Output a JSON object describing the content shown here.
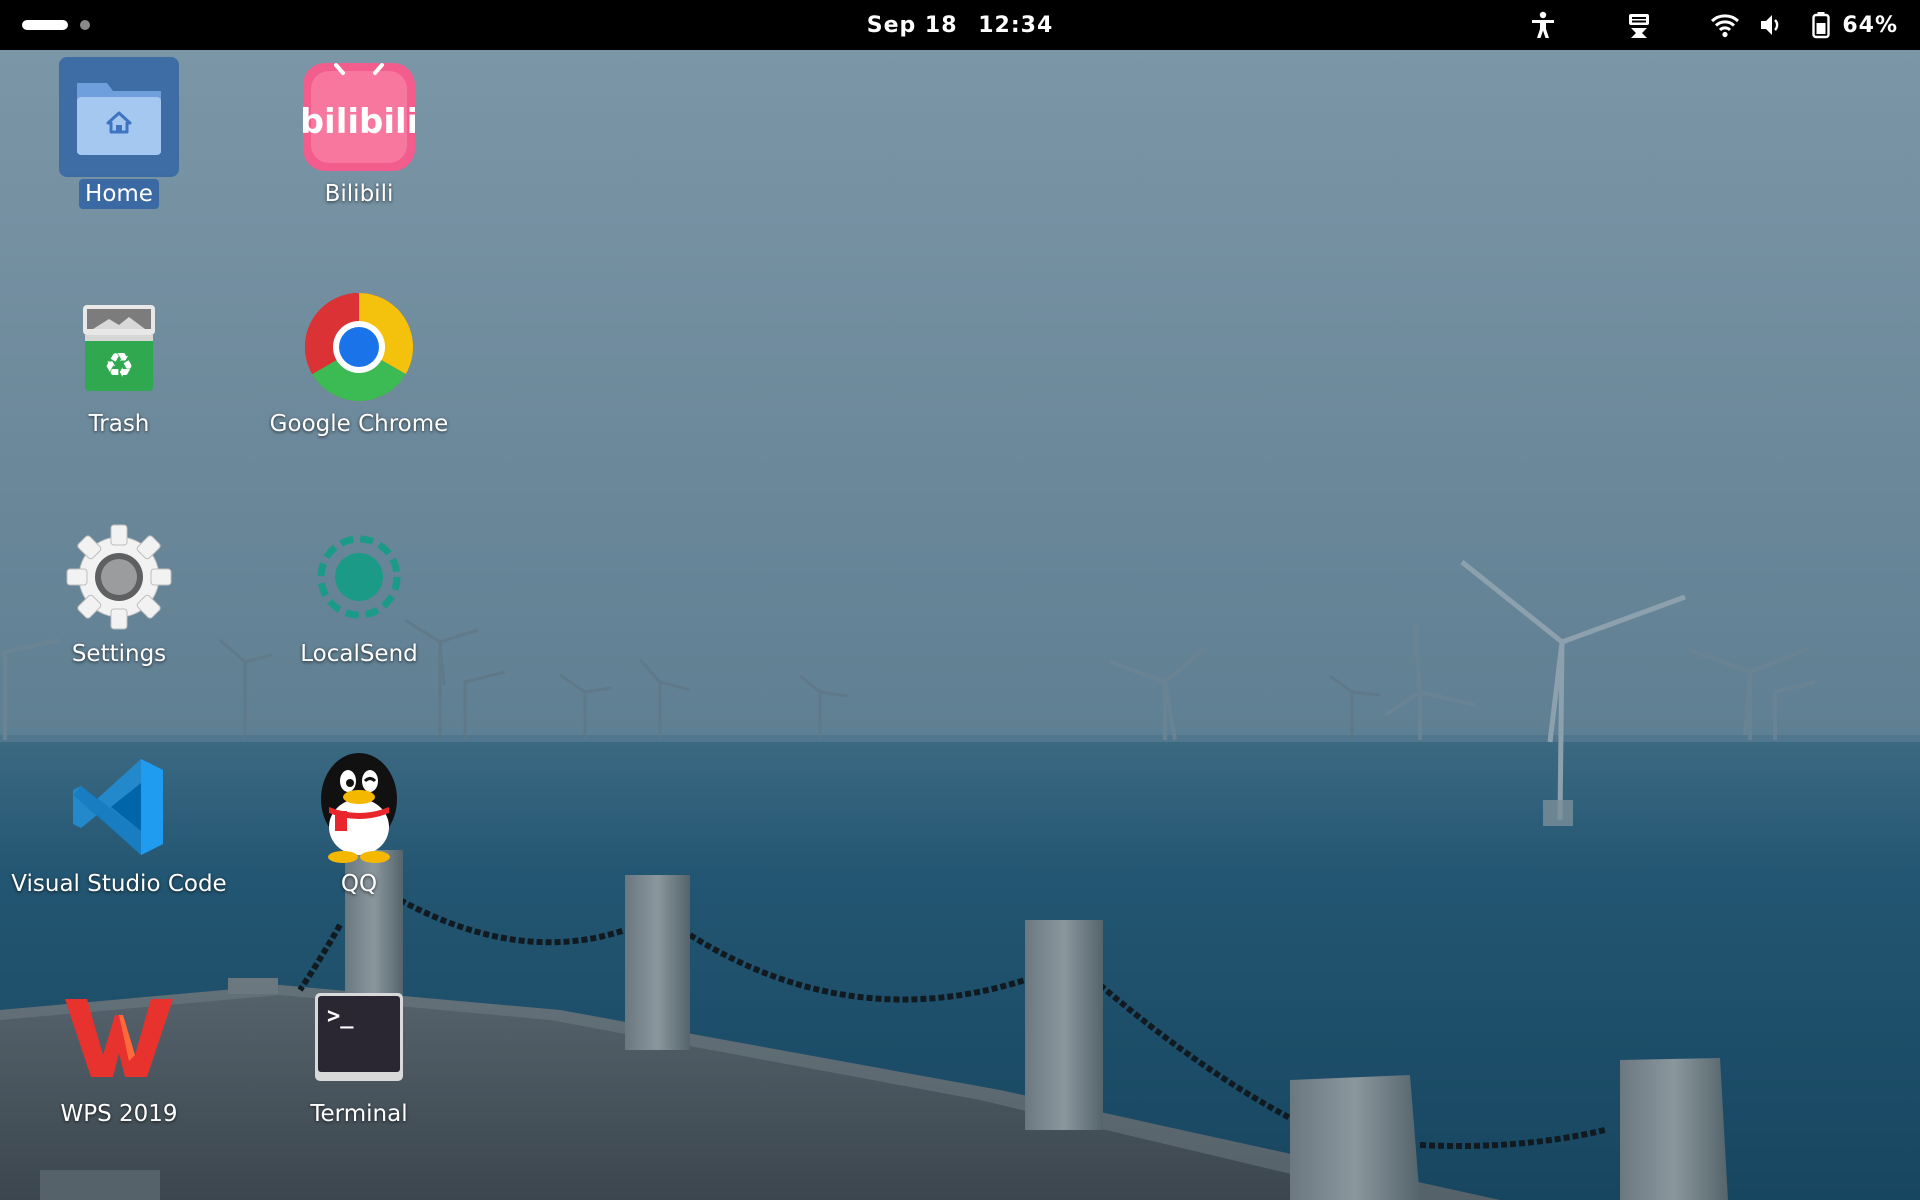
{
  "topbar": {
    "date": "Sep 18",
    "time": "12:34",
    "battery_percent": "64%",
    "tray_icons": [
      "accessibility-icon",
      "input-method-icon",
      "wifi-icon",
      "volume-icon",
      "battery-icon"
    ]
  },
  "desktop": {
    "icons": [
      {
        "label": "Home",
        "icon": "home-folder-icon",
        "selected": true
      },
      {
        "label": "Bilibili",
        "icon": "bilibili-icon"
      },
      {
        "label": "Trash",
        "icon": "trash-icon"
      },
      {
        "label": "Google Chrome",
        "icon": "chrome-icon"
      },
      {
        "label": "Settings",
        "icon": "gear-icon"
      },
      {
        "label": "LocalSend",
        "icon": "localsend-icon"
      },
      {
        "label": "Visual Studio Code",
        "icon": "vscode-icon"
      },
      {
        "label": "QQ",
        "icon": "qq-penguin-icon"
      },
      {
        "label": "WPS 2019",
        "icon": "wps-icon"
      },
      {
        "label": "Terminal",
        "icon": "terminal-icon"
      }
    ]
  },
  "colors": {
    "topbar": "#000000",
    "selection": "#3465a4",
    "bilibili_pink": "#f25d8e",
    "chrome_blue": "#1a73e8",
    "localsend_teal": "#1b9a88",
    "vscode_blue": "#2489ca",
    "wps_red": "#e8322d"
  }
}
